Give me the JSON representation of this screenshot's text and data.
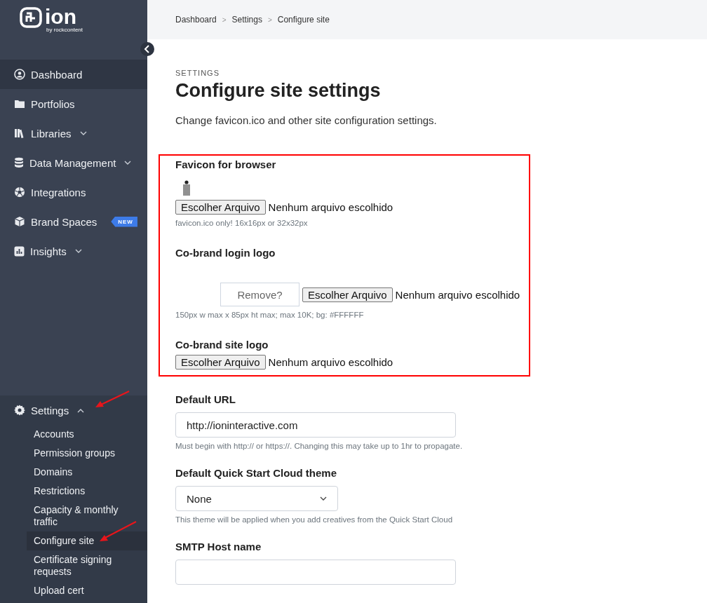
{
  "sidebar": {
    "logo": {
      "name": "ion",
      "tagline": "by rockcontent"
    },
    "items": [
      {
        "label": "Dashboard",
        "selected": true
      },
      {
        "label": "Portfolios",
        "selected": false
      },
      {
        "label": "Libraries",
        "selected": false,
        "expanded": false
      },
      {
        "label": "Data Management",
        "selected": false,
        "expanded": false
      },
      {
        "label": "Integrations",
        "selected": false
      },
      {
        "label": "Brand Spaces",
        "selected": false,
        "badge": "NEW"
      },
      {
        "label": "Insights",
        "selected": false,
        "expanded": false
      }
    ],
    "settings": {
      "label": "Settings",
      "expanded": true,
      "children": [
        {
          "label": "Accounts",
          "selected": false
        },
        {
          "label": "Permission groups",
          "selected": false
        },
        {
          "label": "Domains",
          "selected": false
        },
        {
          "label": "Restrictions",
          "selected": false
        },
        {
          "label": "Capacity & monthly traffic",
          "selected": false
        },
        {
          "label": "Configure site",
          "selected": true
        },
        {
          "label": "Certificate signing requests",
          "selected": false
        },
        {
          "label": "Upload cert",
          "selected": false
        }
      ]
    }
  },
  "breadcrumb": [
    "Dashboard",
    "Settings",
    "Configure site"
  ],
  "breadcrumb_separator": ">",
  "eyebrow": "SETTINGS",
  "title": "Configure site settings",
  "description": "Change favicon.ico and other site configuration settings.",
  "uploads": [
    {
      "label": "Favicon for browser",
      "preview": true,
      "button": "Escolher Arquivo",
      "status": "Nenhum arquivo escolhido",
      "hint": "favicon.ico only! 16x16px or 32x32px"
    },
    {
      "label": "Co-brand login logo",
      "preview": false,
      "remove": "Remove?",
      "button": "Escolher Arquivo",
      "status": "Nenhum arquivo escolhido",
      "hint": "150px w max x 85px ht max; max 10K; bg: #FFFFFF"
    },
    {
      "label": "Co-brand site logo",
      "preview": false,
      "button": "Escolher Arquivo",
      "status": "Nenhum arquivo escolhido"
    }
  ],
  "fields": [
    {
      "kind": "text",
      "label": "Default URL",
      "value": "http://ioninteractive.com",
      "hint": "Must begin with http:// or https://. Changing this may take up to 1hr to propagate."
    },
    {
      "kind": "select",
      "label": "Default Quick Start Cloud theme",
      "value": "None",
      "hint": "This theme will be applied when you add creatives from the Quick Start Cloud"
    },
    {
      "kind": "text",
      "label": "SMTP Host name"
    }
  ]
}
